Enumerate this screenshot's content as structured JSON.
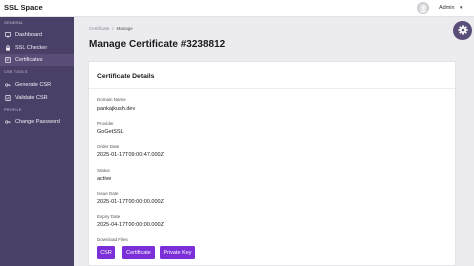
{
  "app": {
    "brand": "SSL Space"
  },
  "topbar": {
    "user_name": "Admin",
    "caret": "▾"
  },
  "sidebar": {
    "sections": [
      {
        "label": "GENERAL"
      },
      {
        "label": "CSR TOOLS"
      },
      {
        "label": "PROFILE"
      }
    ],
    "items": [
      {
        "label": "Dashboard",
        "icon": "monitor-icon"
      },
      {
        "label": "SSL Checker",
        "icon": "lock-icon"
      },
      {
        "label": "Certificates",
        "icon": "certificate-icon"
      },
      {
        "label": "Generate CSR",
        "icon": "key-icon"
      },
      {
        "label": "Validate CSR",
        "icon": "check-file-icon"
      },
      {
        "label": "Change Password",
        "icon": "key-icon"
      }
    ]
  },
  "breadcrumb": {
    "parent": "Certificate",
    "separator": "/",
    "current": "Manage"
  },
  "page": {
    "title": "Manage Certificate #3238812"
  },
  "card": {
    "title": "Certificate Details",
    "fields": [
      {
        "label": "Domain Name",
        "value": "pankajkush.dev"
      },
      {
        "label": "Provider",
        "value": "GoGetSSL"
      },
      {
        "label": "Order Date",
        "value": "2025-01-17T09:00:47.000Z"
      },
      {
        "label": "Status",
        "value": "active"
      },
      {
        "label": "Issue Date",
        "value": "2025-01-17T00:00:00.000Z"
      },
      {
        "label": "Expiry Date",
        "value": "2025-04-17T00:00:00.000Z"
      }
    ],
    "downloads_label": "Download Files",
    "buttons": {
      "csr": "CSR",
      "certificate": "Certificate",
      "private_key": "Private Key"
    }
  },
  "colors": {
    "sidebar": "#4a3f66",
    "accent": "#7b2fd8",
    "gear_button": "#5a4e78"
  },
  "icons": {
    "settings": "gear-icon",
    "avatar": "user-avatar-icon"
  }
}
